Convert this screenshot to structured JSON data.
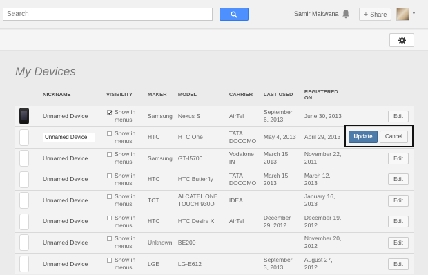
{
  "search": {
    "placeholder": "Search"
  },
  "header": {
    "user_name": "Samir Makwana",
    "share_label": "Share"
  },
  "page": {
    "title": "My Devices"
  },
  "table": {
    "headers": {
      "nickname": "NICKNAME",
      "visibility": "VISIBILITY",
      "maker": "MAKER",
      "model": "MODEL",
      "carrier": "CARRIER",
      "last_used": "LAST USED",
      "registered": "REGISTERED ON"
    },
    "show_in_menus_label": "Show in menus",
    "edit_label": "Edit",
    "rows": [
      {
        "nickname": "Unnamed Device",
        "visible": true,
        "maker": "Samsung",
        "model": "Nexus S",
        "carrier": "AirTel",
        "last_used": "September 6, 2013",
        "registered": "June 30, 2013",
        "dark_image": true
      },
      {
        "nickname": "Unnamed Device",
        "visible": false,
        "maker": "HTC",
        "model": "HTC One",
        "carrier": "TATA DOCOMO",
        "last_used": "May 4, 2013",
        "registered": "April 29, 2013",
        "editing": true
      },
      {
        "nickname": "Unnamed Device",
        "visible": false,
        "maker": "Samsung",
        "model": "GT-I5700",
        "carrier": "Vodafone IN",
        "last_used": "March 15, 2013",
        "registered": "November 22, 2011"
      },
      {
        "nickname": "Unnamed Device",
        "visible": false,
        "maker": "HTC",
        "model": "HTC Butterfly",
        "carrier": "TATA DOCOMO",
        "last_used": "March 15, 2013",
        "registered": "March 12, 2013"
      },
      {
        "nickname": "Unnamed Device",
        "visible": false,
        "maker": "TCT",
        "model": "ALCATEL ONE TOUCH 930D",
        "carrier": "IDEA",
        "last_used": "",
        "registered": "January 16, 2013"
      },
      {
        "nickname": "Unnamed Device",
        "visible": false,
        "maker": "HTC",
        "model": "HTC Desire X",
        "carrier": "AirTel",
        "last_used": "December 29, 2012",
        "registered": "December 19, 2012"
      },
      {
        "nickname": "Unnamed Device",
        "visible": false,
        "maker": "Unknown",
        "model": "BE200",
        "carrier": "",
        "last_used": "",
        "registered": "November 20, 2012"
      },
      {
        "nickname": "Unnamed Device",
        "visible": false,
        "maker": "LGE",
        "model": "LG-E612",
        "carrier": "",
        "last_used": "September 3, 2013",
        "registered": "August 27, 2012"
      }
    ]
  },
  "edit_actions": {
    "update_label": "Update",
    "cancel_label": "Cancel"
  },
  "icons": {
    "search": "search-icon",
    "bell": "bell-icon",
    "gear": "gear-icon",
    "avatar": "avatar"
  },
  "colors": {
    "search_button": "#4d90fe",
    "update_button": "#4d7cab"
  }
}
